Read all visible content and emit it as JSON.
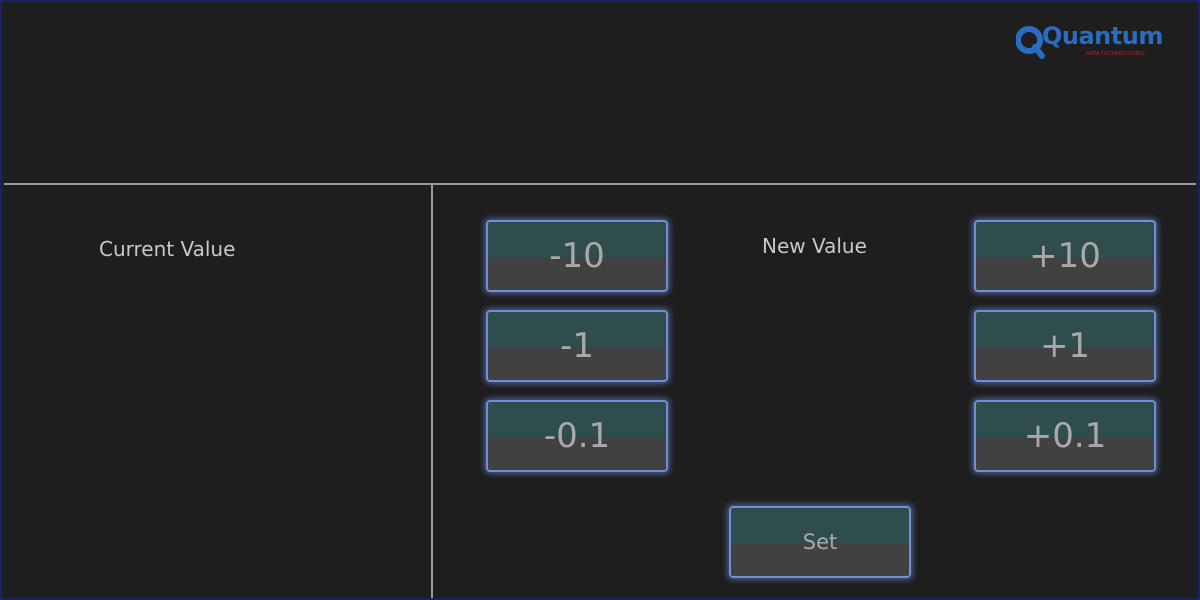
{
  "logo": {
    "name": "Quantum",
    "tagline": "DATA TECHNOLOGIES"
  },
  "current_panel": {
    "label": "Current Value"
  },
  "new_panel": {
    "label": "New Value"
  },
  "buttons": {
    "minus_10": "-10",
    "minus_1": "-1",
    "minus_0_1": "-0.1",
    "plus_10": "+10",
    "plus_1": "+1",
    "plus_0_1": "+0.1",
    "set": "Set"
  },
  "colors": {
    "background": "#1e1e1e",
    "border": "#1a2266",
    "button_top": "#2f4d4d",
    "button_bottom": "#414141",
    "button_glow": "#6f8fd8",
    "logo_blue": "#2a6cc0",
    "logo_red": "#c0202a"
  }
}
